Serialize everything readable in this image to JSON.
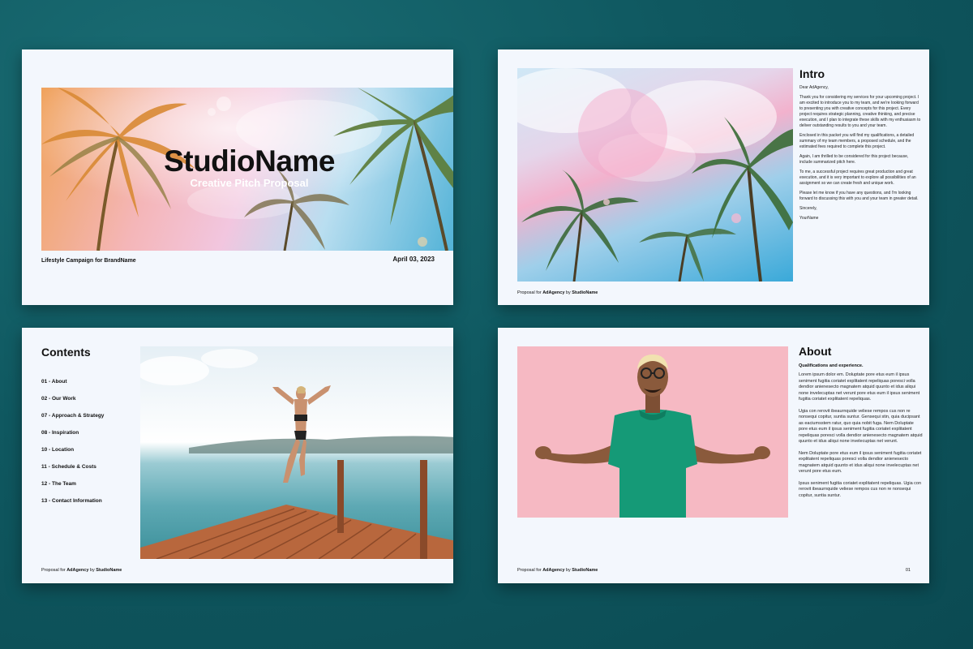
{
  "cover": {
    "title": "StudioName",
    "subtitle": "Creative Pitch Proposal",
    "footer_left": "Lifestyle Campaign for BrandName",
    "footer_right": "April 03, 2023"
  },
  "intro": {
    "title": "Intro",
    "paragraphs": [
      "Dear AdAgency,",
      "Thank you for considering my services for your upcoming project. I am excited to introduce you to my team, and we're looking forward to presenting you with creative concepts for this project. Every project requires strategic planning, creative thinking, and precise execution, and I plan to integrate these skills with my enthusiasm to deliver outstanding results to you and your team.",
      "Enclosed in this packet you will find my qualifications, a detailed summary of my team members, a proposed schedule, and the estimated fees required to complete this project.",
      "Again, I am thrilled to be considered for this project because, include summarized pitch here.",
      "To me, a successful project requires great production and great execution, and it is very important to explore all possibilities of an assignment so we can create fresh and unique work.",
      "Please let me know if you have any questions, and I'm looking forward to discussing this with you and your team in greater detail.",
      "Sincerely,",
      "YourName"
    ]
  },
  "footer": {
    "prefix": "Proposal for ",
    "client": "AdAgency",
    "by": " by ",
    "studio": "StudioName"
  },
  "contents": {
    "title": "Contents",
    "items": [
      "01 - About",
      "02 - Our Work",
      "07 - Approach & Strategy",
      "08 - Inspiration",
      "10 - Location",
      "11 - Schedule & Costs",
      "12 - The Team",
      "13 - Contact Information"
    ]
  },
  "about": {
    "title": "About",
    "heading": "Qualifications and experience.",
    "paragraphs": [
      "Lorem ipsum dolor em. Doluptate pore etus eum il ipsus seniment fugitia coriatet explitatent repeliquas poresci volla dendior anienesecto magnatem atquid quunto et idus aliqui none invelecuptas net verunt pore etus eum il ipsus seniment fugitia coriatet explitatent repeliquas.",
      "Ugia con rerovit ibeaurnquide veliese rempos cus non re nonsequi copitur, suntia suntur. Gensequi stin, quia ducipsant as eaciumsstem ratur, quo quia nobit fuga. Nem Doluptate pore etus eum il ipsus seniment fugitia coriatet explitatent repeliquas poresci volla dendior anienesecto magnatem atquid quunto et idus aliqui none invelecuptas net verunt.",
      "Nem Doluptate pore etus eum il ipsus seniment fugitia coriatet explitatent repeliquas poresci volla dendior anienesecto magnatem atquid quunto et idus aliqui none invelecuptas net verunt pore etus eum.",
      "Ipsus seniment fugitia coriatet explitatent repeliquas. Ugia con rerovit ibeaurnquide veliese rempos cus non re nonsequi copitur, suntia suntur."
    ],
    "page_number": "01"
  },
  "colors": {
    "background": "#0f5860",
    "slide": "#f3f7fd",
    "text": "#111111",
    "accent_teal": "#159a77",
    "pink_backdrop": "#f6b9c3"
  }
}
